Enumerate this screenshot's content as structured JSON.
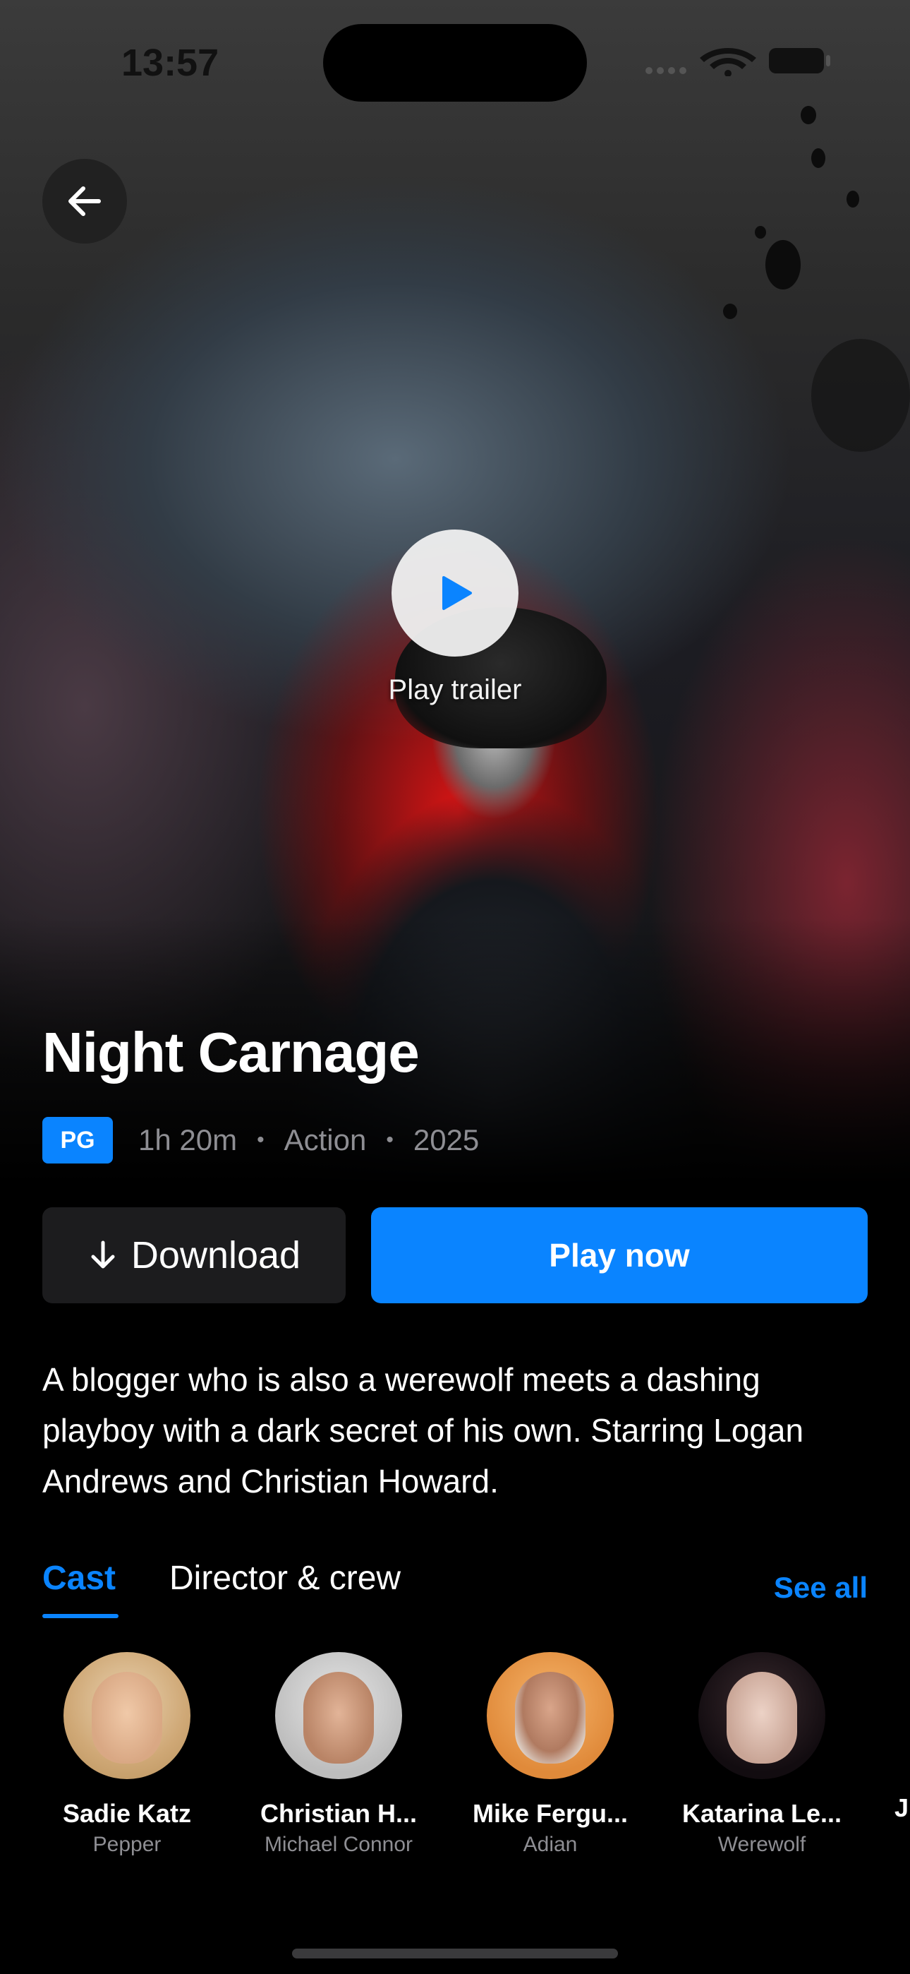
{
  "status_bar": {
    "time": "13:57"
  },
  "hero": {
    "play_trailer_label": "Play trailer"
  },
  "movie": {
    "title": "Night Carnage",
    "rating": "PG",
    "duration": "1h 20m",
    "genre": "Action",
    "year": "2025",
    "description": "A blogger who is also a werewolf meets a dashing playboy with a dark secret of his own. Starring Logan Andrews and Christian Howard."
  },
  "actions": {
    "download_label": "Download",
    "play_now_label": "Play now"
  },
  "tabs": {
    "cast_label": "Cast",
    "crew_label": "Director & crew",
    "see_all_label": "See all"
  },
  "cast": [
    {
      "name": "Sadie Katz",
      "role": "Pepper"
    },
    {
      "name": "Christian H...",
      "role": "Michael Connor"
    },
    {
      "name": "Mike Fergu...",
      "role": "Adian"
    },
    {
      "name": "Katarina Le...",
      "role": "Werewolf"
    }
  ],
  "cast_peek": "J",
  "colors": {
    "accent": "#0a84ff",
    "background": "#000000",
    "secondary_text": "#8e8e93",
    "button_dark": "#1c1c1e"
  }
}
